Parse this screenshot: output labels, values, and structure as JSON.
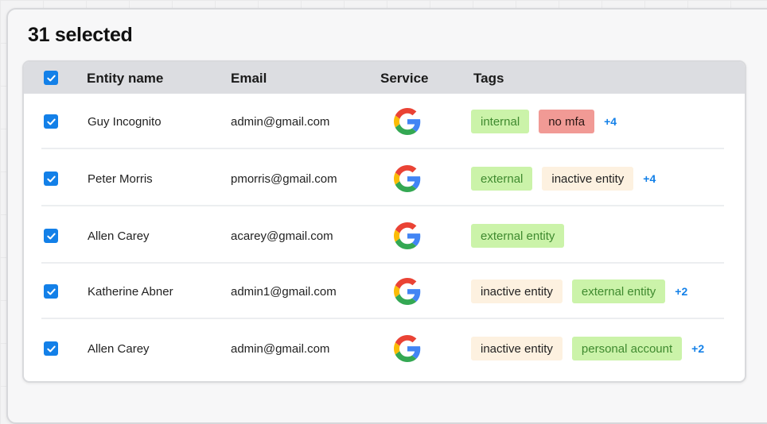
{
  "header": {
    "title": "31 selected"
  },
  "columns": {
    "name": "Entity name",
    "email": "Email",
    "service": "Service",
    "tags": "Tags"
  },
  "rows": [
    {
      "name": "Guy Incognito",
      "email": "admin@gmail.com",
      "service_icon": "google-icon",
      "tags": [
        {
          "label": "internal",
          "color": "green"
        },
        {
          "label": "no mfa",
          "color": "red"
        }
      ],
      "more": "+4"
    },
    {
      "name": "Peter Morris",
      "email": "pmorris@gmail.com",
      "service_icon": "google-icon",
      "tags": [
        {
          "label": "external",
          "color": "green"
        },
        {
          "label": "inactive entity",
          "color": "beige"
        }
      ],
      "more": "+4"
    },
    {
      "name": "Allen Carey",
      "email": "acarey@gmail.com",
      "service_icon": "google-icon",
      "tags": [
        {
          "label": "external entity",
          "color": "green"
        }
      ],
      "more": ""
    },
    {
      "name": "Katherine Abner",
      "email": "admin1@gmail.com",
      "service_icon": "google-icon",
      "tags": [
        {
          "label": "inactive entity",
          "color": "beige"
        },
        {
          "label": "external entity",
          "color": "green"
        }
      ],
      "more": "+2"
    },
    {
      "name": "Allen Carey",
      "email": "admin@gmail.com",
      "service_icon": "google-icon",
      "tags": [
        {
          "label": "inactive entity",
          "color": "beige"
        },
        {
          "label": "personal account",
          "color": "green"
        }
      ],
      "more": "+2"
    }
  ],
  "colors": {
    "accent": "#1380e8",
    "green_tag": "#cbf3a9",
    "red_tag": "#f19a95",
    "beige_tag": "#fdf1e0"
  }
}
